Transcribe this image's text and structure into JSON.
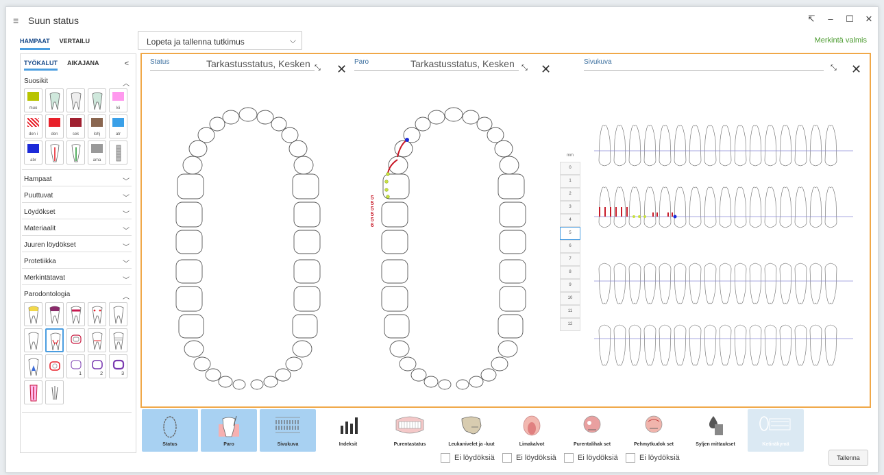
{
  "window": {
    "title": "Suun status",
    "icons": [
      "hamburger-icon",
      "pin-icon",
      "minimize-icon",
      "maximize-icon",
      "close-icon"
    ]
  },
  "tabs": [
    "HAMPAAT",
    "VERTAILU"
  ],
  "toolbar": {
    "dropdown_value": "Lopeta ja tallenna tutkimus",
    "status_text": "Merkintä valmis"
  },
  "left_panel": {
    "tabs": [
      "TYÖKALUT",
      "AIKAJANA"
    ],
    "collapse_label": "<",
    "favorites_title": "Suosikit",
    "favorite_labels": [
      "muo",
      "kii",
      "den i",
      "den",
      "sek",
      "lohj",
      "atr",
      "abr",
      "ama"
    ],
    "colors": {
      "muo": "#b8c400",
      "kii": "#ff99ee",
      "den": "#e8202a",
      "sek": "#a02030",
      "lohj": "#8a6650",
      "atr": "#3aa0e8",
      "abr": "#1c2ad8",
      "ama": "#999999"
    },
    "sections": [
      "Hampaat",
      "Puuttuvat",
      "Löydökset",
      "Materiaalit",
      "Juuren löydökset",
      "Protetiikka",
      "Merkintätavat"
    ],
    "paro_title": "Parodontologia",
    "paro_numbers": [
      "1",
      "2",
      "3"
    ]
  },
  "panels": {
    "status": {
      "label": "Status",
      "subtitle": "Tarkastusstatus, Kesken"
    },
    "paro": {
      "label": "Paro",
      "subtitle": "Tarkastusstatus, Kesken"
    },
    "sivukuva": {
      "label": "Sivukuva"
    }
  },
  "paro_depths": [
    "5",
    "5",
    "5",
    "5",
    "5",
    "6"
  ],
  "mm_scale": {
    "header": "mm",
    "values": [
      "0",
      "1",
      "2",
      "3",
      "4",
      "5",
      "6",
      "7",
      "8",
      "9",
      "10",
      "11",
      "12"
    ],
    "selected": "5"
  },
  "bottom_buttons": [
    "Status",
    "Paro",
    "Sivukuva",
    "Indeksit",
    "Purentastatus",
    "Leukanivelet ja -luut",
    "Limakalvot",
    "Purentalihak set",
    "Pehmytkudok set",
    "Syljen mittaukset",
    "Ketinäkymä"
  ],
  "checkboxes": [
    "Ei löydöksiä",
    "Ei löydöksiä",
    "Ei löydöksiä",
    "Ei löydöksiä"
  ],
  "save_label": "Tallenna"
}
